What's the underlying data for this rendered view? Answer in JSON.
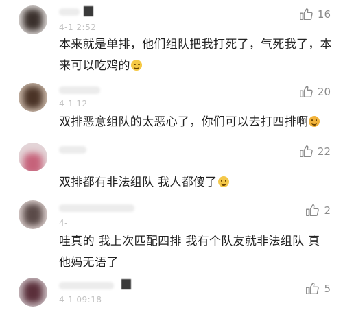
{
  "comments": [
    {
      "time": "4-1 2:52",
      "likes": "16",
      "text": "本来就是单排，他们组队把我打死了，气死我了，本来可以吃鸡的",
      "emoji": "crying-face-emoji"
    },
    {
      "time": "4-1 12",
      "likes": "20",
      "text": "双排恶意组队的太恶心了，你们可以去打四排啊",
      "emoji": "hugging-face-emoji"
    },
    {
      "time": "",
      "likes": "22",
      "text": "双排都有非法组队 我人都傻了",
      "emoji": "smirking-face-emoji"
    },
    {
      "time": "4-",
      "likes": "2",
      "text": "哇真的 我上次匹配四排 我有个队友就非法组队 真他妈无语了",
      "emoji": ""
    },
    {
      "time": "4-1 09:18",
      "likes": "5",
      "text": "",
      "emoji": ""
    }
  ],
  "icons": {
    "like": "thumbs-up-icon"
  },
  "colors": {
    "text": "#222222",
    "meta": "#8a8a8a",
    "background": "#ffffff"
  }
}
